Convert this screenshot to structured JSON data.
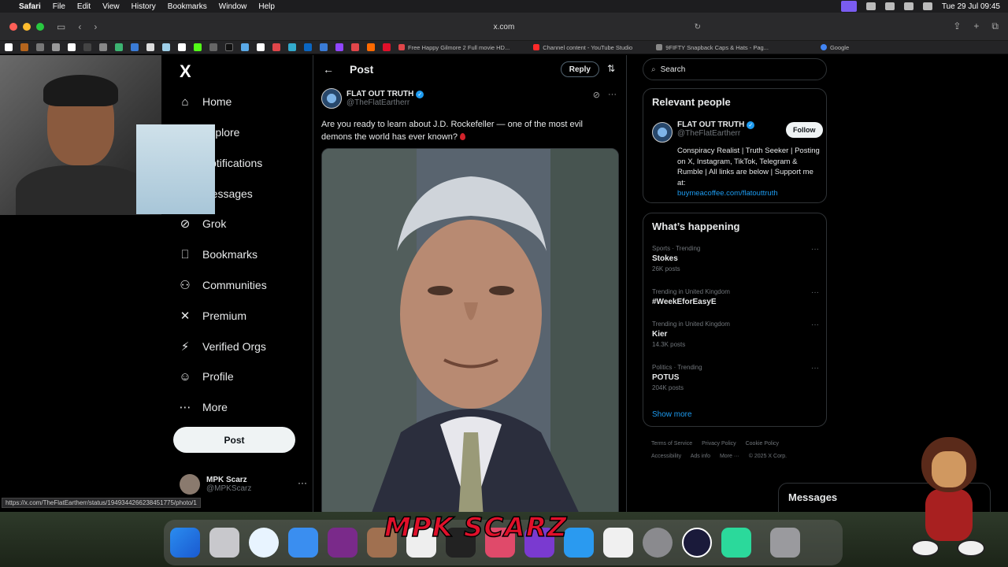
{
  "menubar": {
    "app": "Safari",
    "menus": [
      "File",
      "Edit",
      "View",
      "History",
      "Bookmarks",
      "Window",
      "Help"
    ],
    "datetime": "Tue 29 Jul  09:45"
  },
  "browser": {
    "url": "x.com",
    "tabs": [
      {
        "label": "Free Happy Gilmore 2 Full movie HD...",
        "color": "#e0464a"
      },
      {
        "label": "Channel content - YouTube Studio",
        "color": "#ff2a2a"
      },
      {
        "label": "9FIFTY Snapback Caps & Hats - Pag...",
        "color": "#888888"
      },
      {
        "label": "Google",
        "color": "#4285f4"
      }
    ],
    "status_url": "https://x.com/TheFlatEartherr/status/1949344266238451775/photo/1"
  },
  "nav": {
    "logo": "X",
    "items": [
      {
        "label": "Home",
        "icon": "⌂"
      },
      {
        "label": "Explore",
        "icon": "⌕"
      },
      {
        "label": "Notifications",
        "icon": "🔔"
      },
      {
        "label": "Messages",
        "icon": "✉"
      },
      {
        "label": "Grok",
        "icon": "⊘"
      },
      {
        "label": "Bookmarks",
        "icon": "⎕"
      },
      {
        "label": "Communities",
        "icon": "⚇"
      },
      {
        "label": "Premium",
        "icon": "✕"
      },
      {
        "label": "Verified Orgs",
        "icon": "⚡"
      },
      {
        "label": "Profile",
        "icon": "☺"
      },
      {
        "label": "More",
        "icon": "⋯"
      }
    ],
    "post_button": "Post",
    "account": {
      "name": "MPK Scarz",
      "handle": "@MPKScarz"
    }
  },
  "post": {
    "header_title": "Post",
    "reply_button": "Reply",
    "author_name": "FLAT OUT TRUTH",
    "author_handle": "@TheFlatEartherr",
    "text": "Are you ready to learn about J.D. Rockefeller — one of the most evil demons the world has ever known?"
  },
  "sidebar": {
    "search_placeholder": "Search",
    "relevant": {
      "title": "Relevant people",
      "name": "FLAT OUT TRUTH",
      "handle": "@TheFlatEartherr",
      "follow_label": "Follow",
      "bio": "Conspiracy Realist | Truth Seeker | Posting on X, Instagram, TikTok, Telegram & Rumble | All links are below | Support me at:",
      "bio_link": "buymeacoffee.com/flatouttruth"
    },
    "happening": {
      "title": "What’s happening",
      "trends": [
        {
          "context": "Sports · Trending",
          "topic": "Stokes",
          "count": "26K posts"
        },
        {
          "context": "Trending in United Kingdom",
          "topic": "#WeekEforEasyE",
          "count": ""
        },
        {
          "context": "Trending in United Kingdom",
          "topic": "Kier",
          "count": "14.3K posts"
        },
        {
          "context": "Politics · Trending",
          "topic": "POTUS",
          "count": "204K posts"
        }
      ],
      "show_more": "Show more"
    },
    "footer": [
      "Terms of Service",
      "Privacy Policy",
      "Cookie Policy",
      "Accessibility",
      "Ads info",
      "More ···",
      "© 2025 X Corp."
    ]
  },
  "messages_drawer": "Messages",
  "overlay": {
    "brand": "MPK SCARZ"
  },
  "colors": {
    "accent": "#1d9bf0",
    "background": "#000000",
    "border": "#2f3336"
  }
}
